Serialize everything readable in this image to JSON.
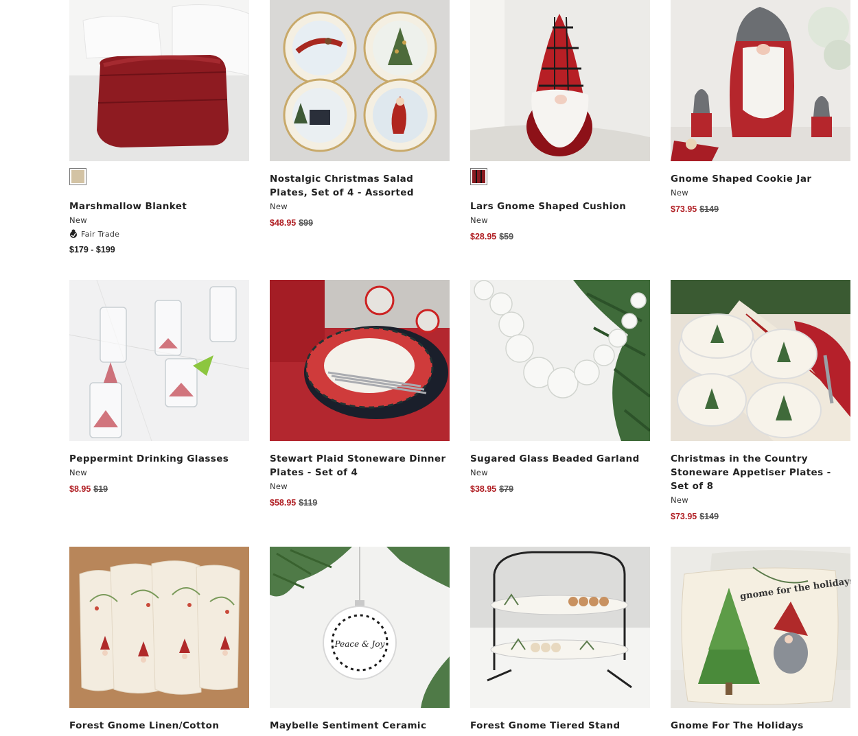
{
  "products": [
    {
      "name": "Marshmallow Blanket",
      "badge": "New",
      "tag": "Fair Trade",
      "range": "$179 - $199",
      "swatch": "#d3c3a4"
    },
    {
      "name": "Nostalgic Christmas Salad Plates, Set of 4 - Assorted",
      "badge": "New",
      "sale": "$48.95",
      "orig": "$99"
    },
    {
      "name": "Lars Gnome Shaped Cushion",
      "badge": "New",
      "sale": "$28.95",
      "orig": "$59",
      "swatch": "#8a1a20"
    },
    {
      "name": "Gnome Shaped Cookie Jar",
      "badge": "New",
      "sale": "$73.95",
      "orig": "$149"
    },
    {
      "name": "Peppermint Drinking Glasses",
      "badge": "New",
      "sale": "$8.95",
      "orig": "$19"
    },
    {
      "name": "Stewart Plaid Stoneware Dinner Plates - Set of 4",
      "badge": "New",
      "sale": "$58.95",
      "orig": "$119"
    },
    {
      "name": "Sugared Glass Beaded Garland",
      "badge": "New",
      "sale": "$38.95",
      "orig": "$79"
    },
    {
      "name": "Christmas in the Country Stoneware Appetiser Plates - Set of 8",
      "badge": "New",
      "sale": "$73.95",
      "orig": "$149"
    },
    {
      "name": "Forest Gnome Linen/Cotton"
    },
    {
      "name": "Maybelle Sentiment Ceramic"
    },
    {
      "name": "Forest Gnome Tiered Stand"
    },
    {
      "name": "Gnome For The Holidays"
    }
  ],
  "ornament_text": "Peace & Joy",
  "pillow_text": "gnome for the holidays",
  "colors": {
    "sale": "#b01e23",
    "text": "#222222"
  }
}
